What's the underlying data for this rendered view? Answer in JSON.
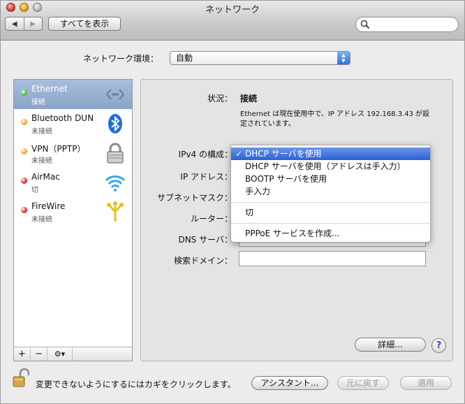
{
  "window": {
    "title": "ネットワーク"
  },
  "toolbar": {
    "back_icon": "◀",
    "forward_icon": "▶",
    "show_all_label": "すべてを表示",
    "search_placeholder": ""
  },
  "location": {
    "label": "ネットワーク環境：",
    "value": "自動"
  },
  "services": [
    {
      "name": "Ethernet",
      "status": "接続",
      "status_color": "#4cc43a",
      "icon": "ethernet-icon",
      "selected": true
    },
    {
      "name": "Bluetooth DUN",
      "status": "未接続",
      "status_color": "#f2a63a",
      "icon": "bluetooth-icon",
      "selected": false
    },
    {
      "name": "VPN（PPTP）",
      "status": "未接続",
      "status_color": "#f2a63a",
      "icon": "lock-icon",
      "selected": false
    },
    {
      "name": "AirMac",
      "status": "切",
      "status_color": "#e0302a",
      "icon": "wifi-icon",
      "selected": false
    },
    {
      "name": "FireWire",
      "status": "未接続",
      "status_color": "#e0302a",
      "icon": "firewire-icon",
      "selected": false
    }
  ],
  "sidebar_tools": {
    "add": "+",
    "remove": "−",
    "action": "⚙▾"
  },
  "detail": {
    "status_label": "状況：",
    "status_value": "接続",
    "status_desc_line1": "Ethernet は現在使用中で、IP アドレス 192.168.3.43 が設",
    "status_desc_line2": "定されています。",
    "ipv4_label": "IPv4 の構成：",
    "ip_label": "IP アドレス：",
    "subnet_label": "サブネットマスク：",
    "router_label": "ルーター：",
    "dns_label": "DNS サーバ：",
    "search_domain_label": "検索ドメイン：",
    "search_domain_value": ""
  },
  "ipv4_menu": {
    "items": [
      {
        "label": "DHCP サーバを使用",
        "checked": true
      },
      {
        "label": "DHCP サーバを使用（アドレスは手入力）"
      },
      {
        "label": "BOOTP サーバを使用"
      },
      {
        "label": "手入力"
      },
      {
        "label": "切"
      },
      {
        "label": "PPPoE サービスを作成..."
      }
    ],
    "check_mark": "✓"
  },
  "buttons": {
    "advanced": "詳細...",
    "help": "?",
    "assistant": "アシスタント...",
    "revert": "元に戻す",
    "apply": "適用"
  },
  "footer": {
    "lock_text": "変更できないようにするにはカギをクリックします。"
  },
  "colors": {
    "selection": "#8aa3c9",
    "menu_highlight": "#2a62d6"
  }
}
